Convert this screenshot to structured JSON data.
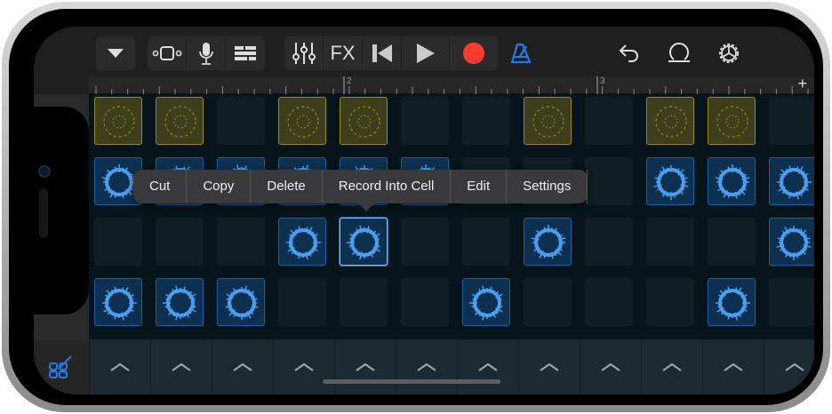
{
  "toolbar": {
    "view_menu_icon": "triangle-down-icon",
    "browser_icon": "live-loops-icon",
    "mic_icon": "microphone-icon",
    "tracks_icon": "tracks-view-icon",
    "mixer_icon": "mixer-sliders-icon",
    "fx_label": "FX",
    "rewind_icon": "go-to-start-icon",
    "play_icon": "play-icon",
    "record_icon": "record-icon",
    "metronome_icon": "metronome-icon",
    "undo_icon": "undo-icon",
    "loop_icon": "loop-browser-icon",
    "settings_icon": "settings-gear-icon"
  },
  "ruler": {
    "marks": [
      "2",
      "3"
    ],
    "add_label": "+"
  },
  "context_menu": {
    "items": [
      "Cut",
      "Copy",
      "Delete",
      "Record Into Cell",
      "Edit",
      "Settings"
    ]
  },
  "grid": {
    "columns": 12,
    "rows": [
      {
        "type": "y",
        "filled": [
          0,
          1,
          3,
          4,
          7,
          9,
          10
        ]
      },
      {
        "type": "b",
        "filled": [
          0,
          1,
          2,
          3,
          4,
          5,
          9,
          10,
          11
        ]
      },
      {
        "type": "b",
        "filled": [
          3,
          4,
          7,
          11
        ],
        "selected": 4
      },
      {
        "type": "b",
        "filled": [
          0,
          1,
          2,
          6,
          10
        ]
      }
    ]
  },
  "bottom": {
    "edit_icon": "edit-grid-icon",
    "trigger_count": 12
  },
  "colors": {
    "accent": "#1e7bf0",
    "record": "#ff3b30",
    "yellow_cell": "#9a8a1e",
    "blue_cell": "#4a9ef0"
  }
}
